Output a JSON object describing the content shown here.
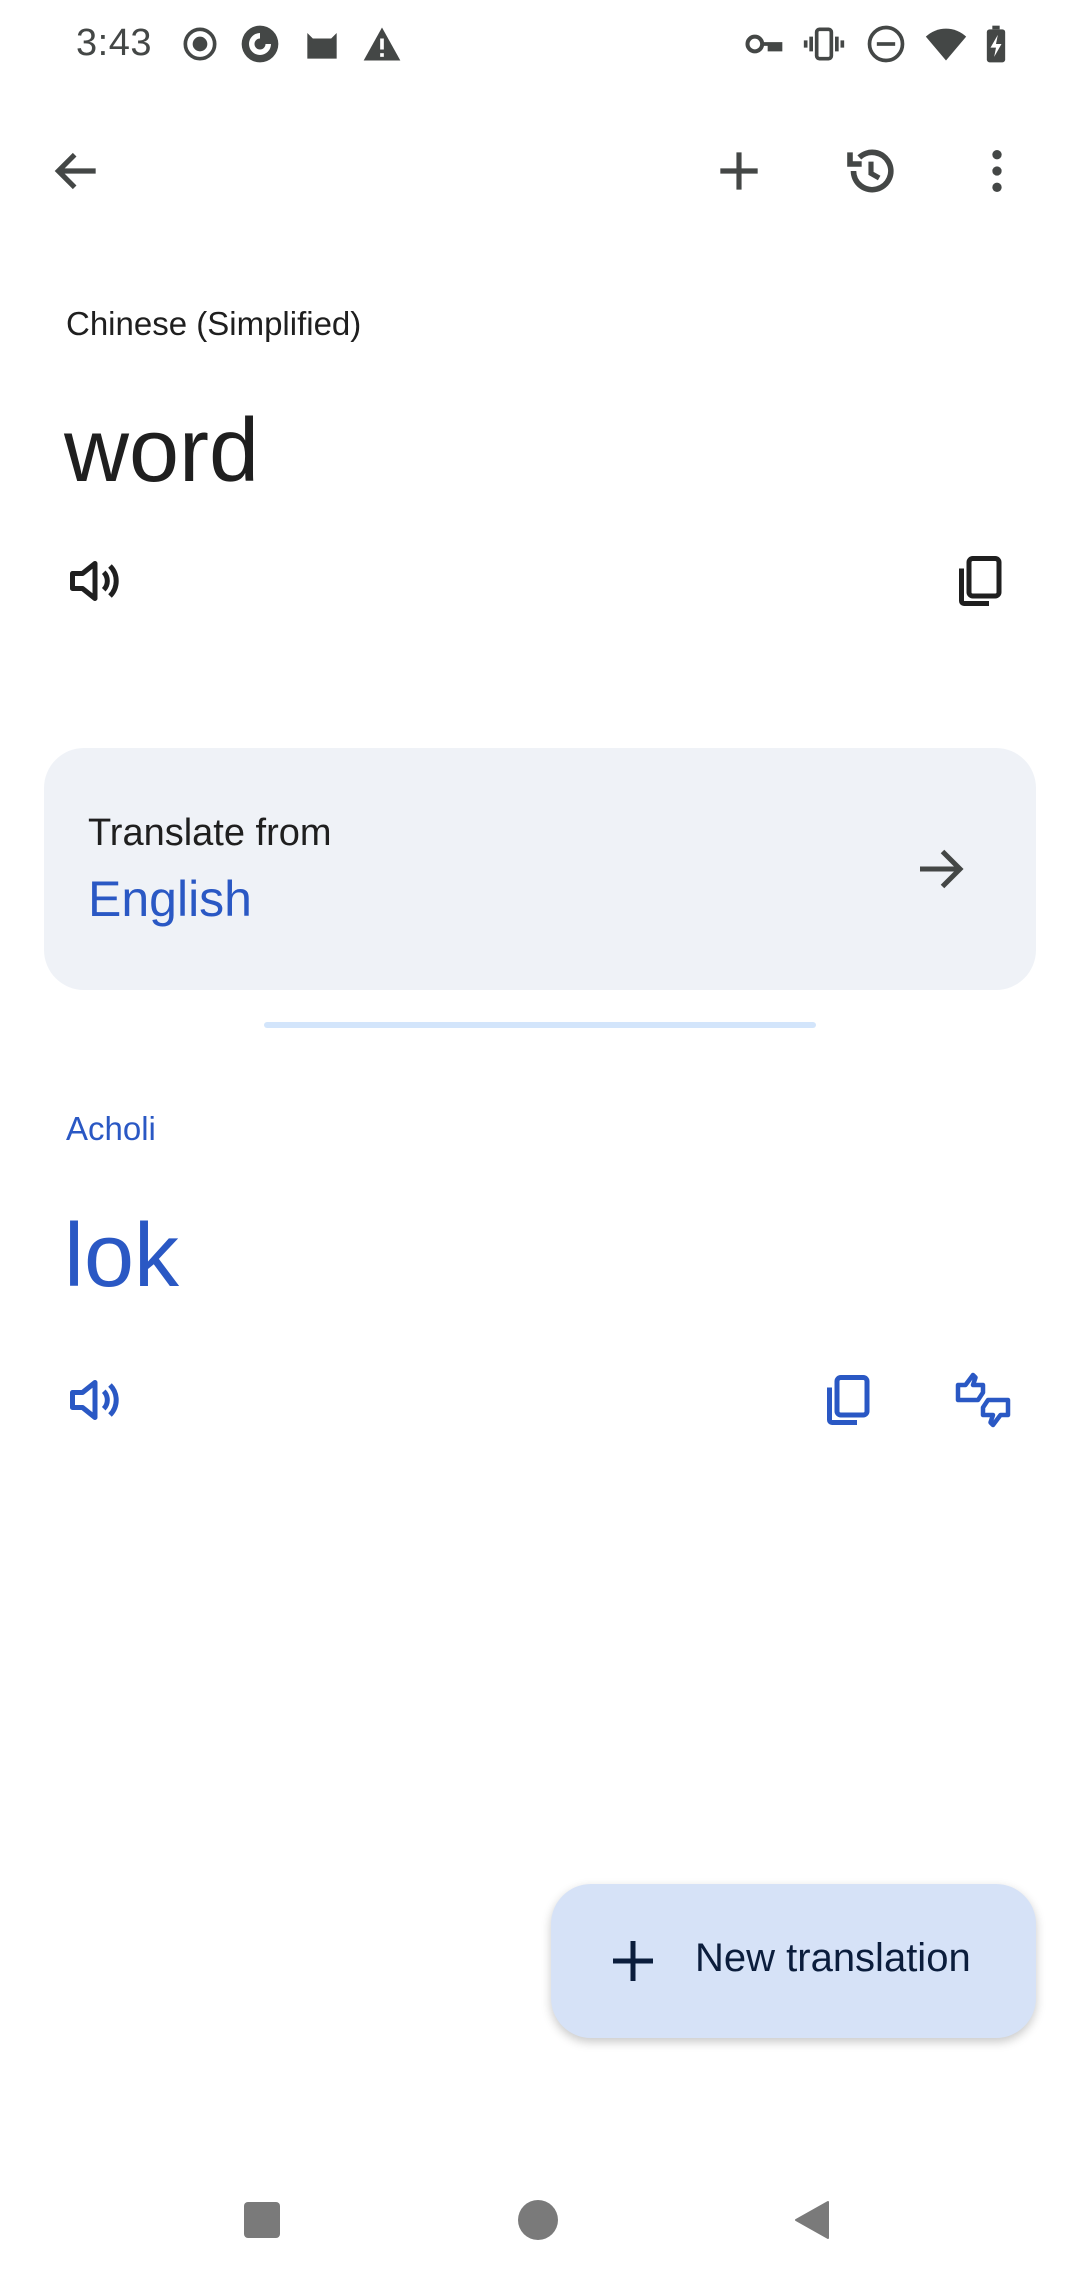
{
  "status_bar": {
    "time": "3:43",
    "left_icons": [
      "record-icon",
      "browser-icon",
      "cat-icon",
      "warning-icon"
    ],
    "right_icons": [
      "vpn-key-icon",
      "vibrate-icon",
      "do-not-disturb-icon",
      "wifi-icon",
      "battery-charging-icon"
    ]
  },
  "toolbar": {
    "back_icon": "arrow-back-icon",
    "new_icon": "plus-icon",
    "history_icon": "history-icon",
    "more_icon": "more-vert-icon"
  },
  "source": {
    "language": "Chinese (Simplified)",
    "text": "word"
  },
  "translate_from": {
    "label": "Translate from",
    "language": "English"
  },
  "target": {
    "language": "Acholi",
    "text": "lok"
  },
  "fab": {
    "label": "New translation"
  },
  "colors": {
    "accent": "#2a58c4",
    "card_bg": "#eff2f7",
    "fab_bg": "#d6e2f7",
    "divider": "#d3e5fb",
    "icon_gray": "#444746"
  }
}
